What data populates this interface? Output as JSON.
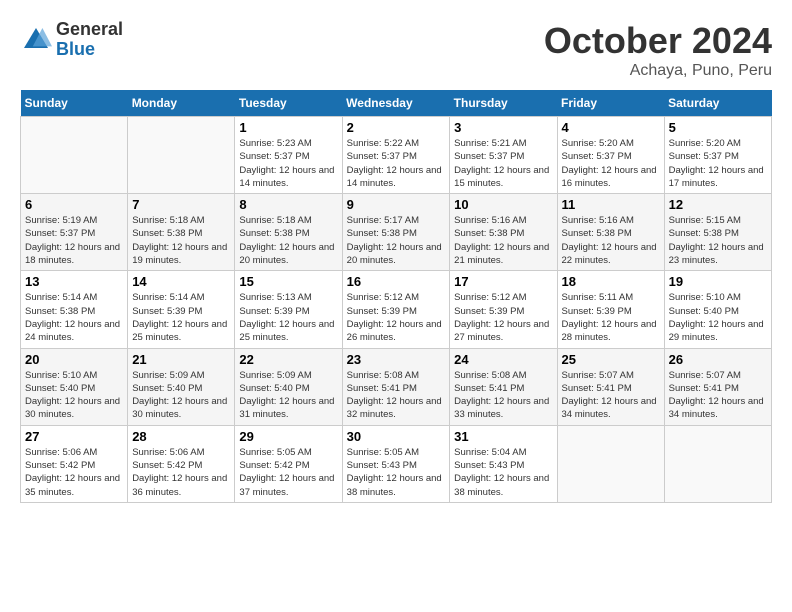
{
  "header": {
    "logo": {
      "general": "General",
      "blue": "Blue"
    },
    "title": "October 2024",
    "location": "Achaya, Puno, Peru"
  },
  "days_of_week": [
    "Sunday",
    "Monday",
    "Tuesday",
    "Wednesday",
    "Thursday",
    "Friday",
    "Saturday"
  ],
  "weeks": [
    [
      {
        "day": "",
        "content": ""
      },
      {
        "day": "",
        "content": ""
      },
      {
        "day": "1",
        "content": "Sunrise: 5:23 AM\nSunset: 5:37 PM\nDaylight: 12 hours and 14 minutes."
      },
      {
        "day": "2",
        "content": "Sunrise: 5:22 AM\nSunset: 5:37 PM\nDaylight: 12 hours and 14 minutes."
      },
      {
        "day": "3",
        "content": "Sunrise: 5:21 AM\nSunset: 5:37 PM\nDaylight: 12 hours and 15 minutes."
      },
      {
        "day": "4",
        "content": "Sunrise: 5:20 AM\nSunset: 5:37 PM\nDaylight: 12 hours and 16 minutes."
      },
      {
        "day": "5",
        "content": "Sunrise: 5:20 AM\nSunset: 5:37 PM\nDaylight: 12 hours and 17 minutes."
      }
    ],
    [
      {
        "day": "6",
        "content": "Sunrise: 5:19 AM\nSunset: 5:37 PM\nDaylight: 12 hours and 18 minutes."
      },
      {
        "day": "7",
        "content": "Sunrise: 5:18 AM\nSunset: 5:38 PM\nDaylight: 12 hours and 19 minutes."
      },
      {
        "day": "8",
        "content": "Sunrise: 5:18 AM\nSunset: 5:38 PM\nDaylight: 12 hours and 20 minutes."
      },
      {
        "day": "9",
        "content": "Sunrise: 5:17 AM\nSunset: 5:38 PM\nDaylight: 12 hours and 20 minutes."
      },
      {
        "day": "10",
        "content": "Sunrise: 5:16 AM\nSunset: 5:38 PM\nDaylight: 12 hours and 21 minutes."
      },
      {
        "day": "11",
        "content": "Sunrise: 5:16 AM\nSunset: 5:38 PM\nDaylight: 12 hours and 22 minutes."
      },
      {
        "day": "12",
        "content": "Sunrise: 5:15 AM\nSunset: 5:38 PM\nDaylight: 12 hours and 23 minutes."
      }
    ],
    [
      {
        "day": "13",
        "content": "Sunrise: 5:14 AM\nSunset: 5:38 PM\nDaylight: 12 hours and 24 minutes."
      },
      {
        "day": "14",
        "content": "Sunrise: 5:14 AM\nSunset: 5:39 PM\nDaylight: 12 hours and 25 minutes."
      },
      {
        "day": "15",
        "content": "Sunrise: 5:13 AM\nSunset: 5:39 PM\nDaylight: 12 hours and 25 minutes."
      },
      {
        "day": "16",
        "content": "Sunrise: 5:12 AM\nSunset: 5:39 PM\nDaylight: 12 hours and 26 minutes."
      },
      {
        "day": "17",
        "content": "Sunrise: 5:12 AM\nSunset: 5:39 PM\nDaylight: 12 hours and 27 minutes."
      },
      {
        "day": "18",
        "content": "Sunrise: 5:11 AM\nSunset: 5:39 PM\nDaylight: 12 hours and 28 minutes."
      },
      {
        "day": "19",
        "content": "Sunrise: 5:10 AM\nSunset: 5:40 PM\nDaylight: 12 hours and 29 minutes."
      }
    ],
    [
      {
        "day": "20",
        "content": "Sunrise: 5:10 AM\nSunset: 5:40 PM\nDaylight: 12 hours and 30 minutes."
      },
      {
        "day": "21",
        "content": "Sunrise: 5:09 AM\nSunset: 5:40 PM\nDaylight: 12 hours and 30 minutes."
      },
      {
        "day": "22",
        "content": "Sunrise: 5:09 AM\nSunset: 5:40 PM\nDaylight: 12 hours and 31 minutes."
      },
      {
        "day": "23",
        "content": "Sunrise: 5:08 AM\nSunset: 5:41 PM\nDaylight: 12 hours and 32 minutes."
      },
      {
        "day": "24",
        "content": "Sunrise: 5:08 AM\nSunset: 5:41 PM\nDaylight: 12 hours and 33 minutes."
      },
      {
        "day": "25",
        "content": "Sunrise: 5:07 AM\nSunset: 5:41 PM\nDaylight: 12 hours and 34 minutes."
      },
      {
        "day": "26",
        "content": "Sunrise: 5:07 AM\nSunset: 5:41 PM\nDaylight: 12 hours and 34 minutes."
      }
    ],
    [
      {
        "day": "27",
        "content": "Sunrise: 5:06 AM\nSunset: 5:42 PM\nDaylight: 12 hours and 35 minutes."
      },
      {
        "day": "28",
        "content": "Sunrise: 5:06 AM\nSunset: 5:42 PM\nDaylight: 12 hours and 36 minutes."
      },
      {
        "day": "29",
        "content": "Sunrise: 5:05 AM\nSunset: 5:42 PM\nDaylight: 12 hours and 37 minutes."
      },
      {
        "day": "30",
        "content": "Sunrise: 5:05 AM\nSunset: 5:43 PM\nDaylight: 12 hours and 38 minutes."
      },
      {
        "day": "31",
        "content": "Sunrise: 5:04 AM\nSunset: 5:43 PM\nDaylight: 12 hours and 38 minutes."
      },
      {
        "day": "",
        "content": ""
      },
      {
        "day": "",
        "content": ""
      }
    ]
  ]
}
